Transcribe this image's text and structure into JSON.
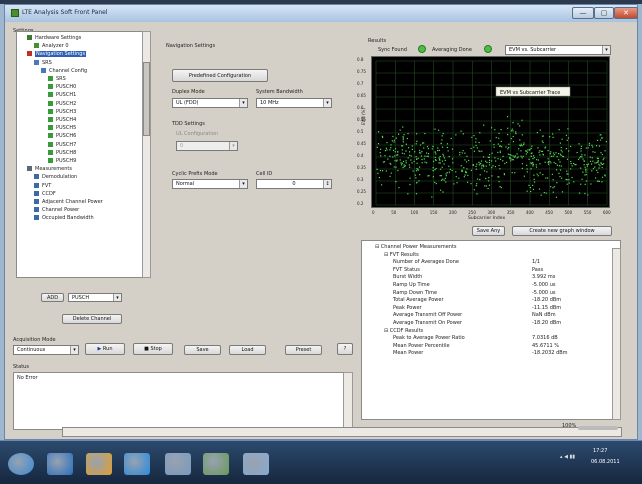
{
  "window": {
    "title": "LTE Analysis Soft Front Panel",
    "min": "—",
    "max": "▢",
    "close": "✕"
  },
  "settings": {
    "label": "Settings",
    "tree": [
      {
        "label": "Hardware Settings",
        "indent": 1,
        "icon": "hardware-icon",
        "color": "#3c7a2a"
      },
      {
        "label": "Analyzer 0",
        "indent": 2,
        "icon": "analyzer-icon",
        "color": "#4a8f2e"
      },
      {
        "label": "Navigation Settings",
        "indent": 1,
        "icon": "navigation-icon",
        "color": "#c03020",
        "selected": true
      },
      {
        "label": "SRS",
        "indent": 2,
        "icon": "folder-icon",
        "color": "#4a78b8"
      },
      {
        "label": "Channel Config",
        "indent": 3,
        "icon": "config-icon",
        "color": "#4a78b8"
      },
      {
        "label": "SRS",
        "indent": 4,
        "icon": "signal-icon",
        "color": "#3a9a3a"
      },
      {
        "label": "PUSCH0",
        "indent": 4,
        "icon": "signal-icon",
        "color": "#3a9a3a"
      },
      {
        "label": "PUSCH1",
        "indent": 4,
        "icon": "signal-icon",
        "color": "#3a9a3a"
      },
      {
        "label": "PUSCH2",
        "indent": 4,
        "icon": "signal-icon",
        "color": "#3a9a3a"
      },
      {
        "label": "PUSCH3",
        "indent": 4,
        "icon": "signal-icon",
        "color": "#3a9a3a"
      },
      {
        "label": "PUSCH4",
        "indent": 4,
        "icon": "signal-icon",
        "color": "#3a9a3a"
      },
      {
        "label": "PUSCH5",
        "indent": 4,
        "icon": "signal-icon",
        "color": "#3a9a3a"
      },
      {
        "label": "PUSCH6",
        "indent": 4,
        "icon": "signal-icon",
        "color": "#3a9a3a"
      },
      {
        "label": "PUSCH7",
        "indent": 4,
        "icon": "signal-icon",
        "color": "#3a9a3a"
      },
      {
        "label": "PUSCH8",
        "indent": 4,
        "icon": "signal-icon",
        "color": "#3a9a3a"
      },
      {
        "label": "PUSCH9",
        "indent": 4,
        "icon": "signal-icon",
        "color": "#3a9a3a"
      },
      {
        "label": "Measurements",
        "indent": 1,
        "icon": "measurements-icon",
        "color": "#5a6a7a"
      },
      {
        "label": "Demodulation",
        "indent": 2,
        "icon": "demod-icon",
        "color": "#3a6aa8"
      },
      {
        "label": "FVT",
        "indent": 2,
        "icon": "fvt-icon",
        "color": "#3a6aa8"
      },
      {
        "label": "CCDF",
        "indent": 2,
        "icon": "ccdf-icon",
        "color": "#3a6aa8"
      },
      {
        "label": "Adjacent Channel Power",
        "indent": 2,
        "icon": "acp-icon",
        "color": "#3a6aa8"
      },
      {
        "label": "Channel Power",
        "indent": 2,
        "icon": "chp-icon",
        "color": "#3a6aa8"
      },
      {
        "label": "Occupied Bandwidth",
        "indent": 2,
        "icon": "obw-icon",
        "color": "#3a6aa8"
      }
    ],
    "add_button": "ADD",
    "channel_select": "PUSCH",
    "delete_button": "Delete Channel"
  },
  "nav_settings": {
    "label": "Navigation Settings",
    "predefined_button": "Predefined Configuration",
    "duplex_label": "Duplex Mode",
    "duplex_value": "UL (FDD)",
    "bw_label": "System Bandwidth",
    "bw_value": "10 MHz",
    "tdd_label": "TDD Settings",
    "ul_config_label": "UL Configuration",
    "ul_config_value": "0",
    "cp_label": "Cyclic Prefix Mode",
    "cp_value": "Normal",
    "cell_label": "Cell ID",
    "cell_value": "0"
  },
  "results": {
    "label": "Results",
    "sync_label": "Sync Found",
    "avg_label": "Averaging Done",
    "view_select": "EVM vs. Subcarrier",
    "graph_caption": "EVM vs Subcarrier Trace",
    "save_button": "Save Any",
    "new_graph_button": "Create new graph window",
    "tree": [
      {
        "label": "Channel Power Measurements",
        "value": "",
        "level": 1
      },
      {
        "label": "FVT Results",
        "value": "",
        "level": 2
      },
      {
        "label": "Number of Averages Done",
        "value": "1/1",
        "level": 3
      },
      {
        "label": "FVT Status",
        "value": "Pass",
        "level": 3
      },
      {
        "label": "Burst Width",
        "value": "3.992 ms",
        "level": 3
      },
      {
        "label": "Ramp Up Time",
        "value": "-5.000 us",
        "level": 3
      },
      {
        "label": "Ramp Down Time",
        "value": "-5.000 us",
        "level": 3
      },
      {
        "label": "Total Average Power",
        "value": "-18.20 dBm",
        "level": 3
      },
      {
        "label": "Peak Power",
        "value": "-11.15 dBm",
        "level": 3
      },
      {
        "label": "Average Transmit Off Power",
        "value": "NaN dBm",
        "level": 3
      },
      {
        "label": "Average Transmit On Power",
        "value": "-18.20 dBm",
        "level": 3
      },
      {
        "label": "CCDF Results",
        "value": "",
        "level": 2
      },
      {
        "label": "Peak to Average Power Ratio",
        "value": "7.0316 dB",
        "level": 3
      },
      {
        "label": "Mean Power Percentile",
        "value": "45.6711 %",
        "level": 3
      },
      {
        "label": "Mean Power",
        "value": "-18.2032 dBm",
        "level": 3
      }
    ]
  },
  "chart_data": {
    "type": "scatter",
    "title": "EVM vs Subcarrier Trace",
    "xlabel": "Subcarrier Index",
    "ylabel": "EVM (%)",
    "x_ticks": [
      "0",
      "50",
      "100",
      "150",
      "200",
      "250",
      "300",
      "350",
      "400",
      "450",
      "500",
      "550",
      "600"
    ],
    "y_ticks": [
      "0.8",
      "0.75",
      "0.7",
      "0.65",
      "0.6",
      "0.55",
      "0.5",
      "0.45",
      "0.4",
      "0.35",
      "0.3",
      "0.25",
      "0.2"
    ],
    "xlim": [
      0,
      600
    ],
    "ylim": [
      0.2,
      0.8
    ],
    "grid": true,
    "point_color": "#55e055",
    "band": {
      "mean": 0.38,
      "spread": 0.12,
      "count": 620
    }
  },
  "acquisition": {
    "label": "Acquisition Mode",
    "mode_value": "Continuous",
    "run_button": "Run",
    "stop_button": "Stop",
    "save_button": "Save",
    "load_button": "Load",
    "preset_button": "Preset",
    "help_button": "?"
  },
  "status": {
    "label": "Status",
    "text": "No Error"
  },
  "bottom": {
    "zoom": "100%"
  },
  "taskbar": {
    "time": "17:27",
    "date": "06.08.2011",
    "icons": [
      {
        "name": "start-orb-icon",
        "color": "#3a8ad8"
      },
      {
        "name": "media-player-icon",
        "color": "#2a6fc0"
      },
      {
        "name": "explorer-icon",
        "color": "#e0a030"
      },
      {
        "name": "internet-explorer-icon",
        "color": "#2a8ae0"
      },
      {
        "name": "app-window-icon",
        "color": "#7a9ac0"
      },
      {
        "name": "lte-panel-icon",
        "color": "#6a9a5a"
      },
      {
        "name": "monitor-icon",
        "color": "#8aaad0"
      }
    ]
  }
}
